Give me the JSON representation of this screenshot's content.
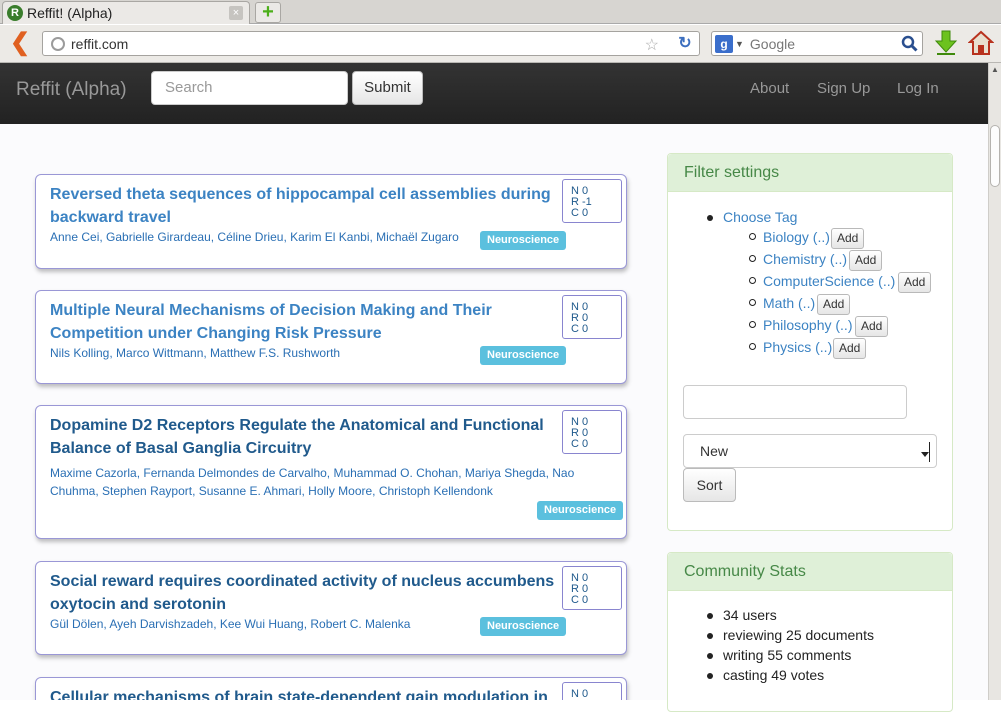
{
  "browser": {
    "tab_title": "Reffit! (Alpha)",
    "tab_close": "×",
    "new_tab": "+",
    "url": "reffit.com",
    "search_engine_letter": "g",
    "search_placeholder": "Google"
  },
  "navbar": {
    "brand": "Reffit (Alpha)",
    "search_placeholder": "Search",
    "submit_label": "Submit",
    "links": [
      "About",
      "Sign Up",
      "Log In"
    ]
  },
  "papers": [
    {
      "title": "Reversed theta sequences of hippocampal cell assemblies during backward travel",
      "authors": "Anne Cei, Gabrielle Girardeau, Céline Drieu, Karim El Kanbi, Michaël Zugaro",
      "tag": "Neuroscience",
      "scores": [
        "N 0",
        "R -1",
        "C 0"
      ]
    },
    {
      "title": "Multiple Neural Mechanisms of Decision Making and Their Competition under Changing Risk Pressure",
      "authors": "Nils Kolling, Marco Wittmann, Matthew F.S. Rushworth",
      "tag": "Neuroscience",
      "scores": [
        "N 0",
        "R 0",
        "C 0"
      ]
    },
    {
      "title": "Dopamine D2 Receptors Regulate the Anatomical and Functional Balance of Basal Ganglia Circuitry",
      "authors_line1": "Maxime Cazorla, Fernanda Delmondes de Carvalho, Muhammad O. Chohan, Mariya Shegda, Nao",
      "authors_line2": "Chuhma, Stephen Rayport, Susanne E. Ahmari, Holly Moore, Christoph Kellendonk",
      "tag": "Neuroscience",
      "scores": [
        "N 0",
        "R 0",
        "C 0"
      ]
    },
    {
      "title": "Social reward requires coordinated activity of nucleus accumbens oxytocin and serotonin",
      "authors": "Gül Dölen, Ayeh Darvishzadeh, Kee Wui Huang, Robert C. Malenka",
      "tag": "Neuroscience",
      "scores": [
        "N 0",
        "R 0",
        "C 0"
      ]
    },
    {
      "title": "Cellular mechanisms of brain state-dependent gain modulation in",
      "scores": [
        "N 0"
      ]
    }
  ],
  "filter": {
    "heading": "Filter settings",
    "root_label": "Choose Tag",
    "tags": [
      {
        "label": "Biology (..)",
        "add": "Add"
      },
      {
        "label": "Chemistry (..)",
        "add": "Add"
      },
      {
        "label": "ComputerScience (..)",
        "add": "Add"
      },
      {
        "label": "Math (..)",
        "add": "Add"
      },
      {
        "label": "Philosophy (..)",
        "add": "Add"
      },
      {
        "label": "Physics (..)",
        "add": "Add"
      }
    ],
    "sort_selected": "New",
    "sort_button": "Sort"
  },
  "community": {
    "heading": "Community Stats",
    "stats": [
      "34 users",
      "reviewing 25 documents",
      "writing 55 comments",
      "casting 49 votes"
    ]
  }
}
